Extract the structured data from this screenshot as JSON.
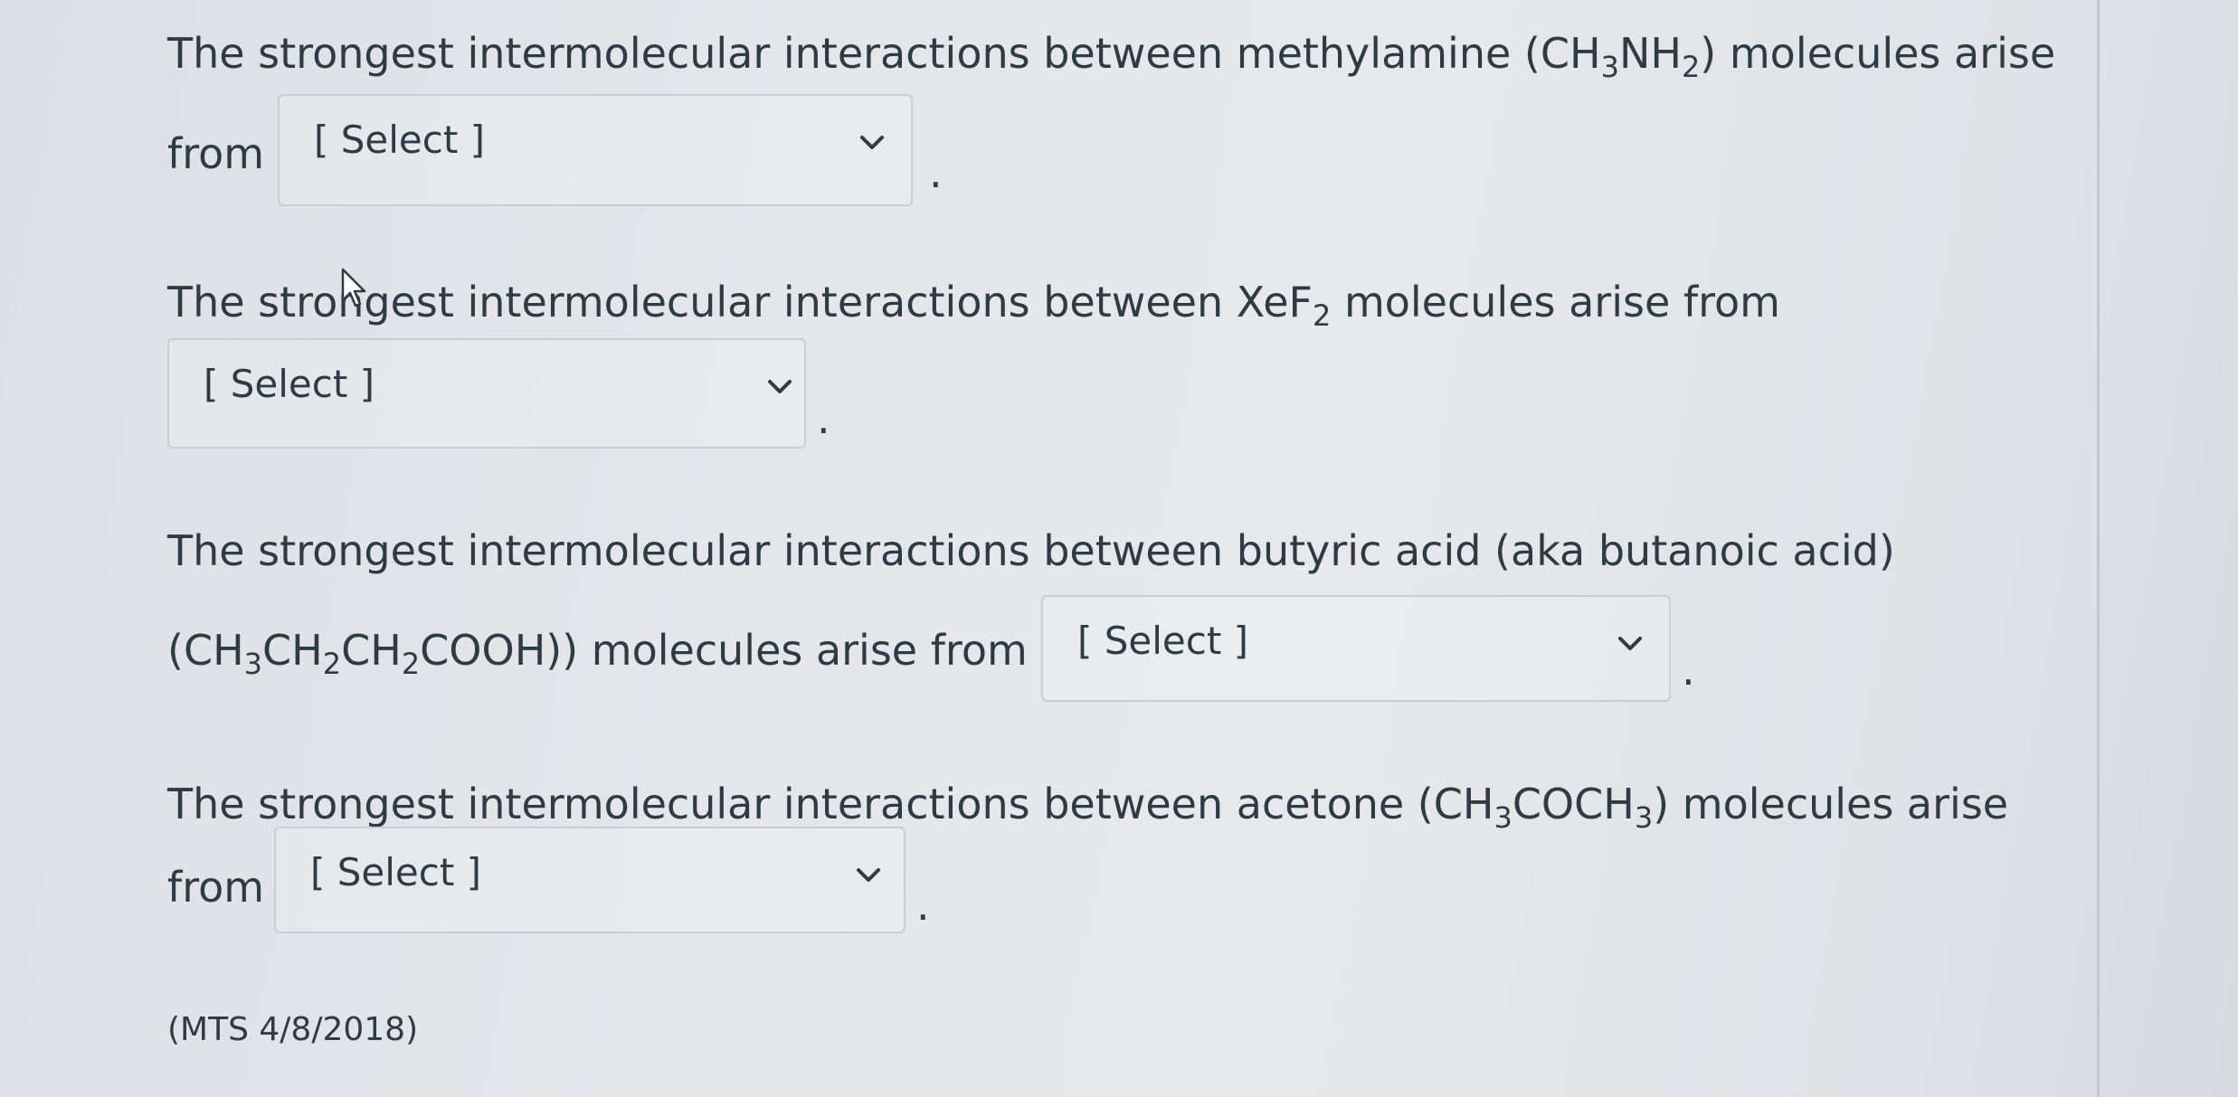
{
  "questions": [
    {
      "line1": {
        "intro": "The strongest intermolecular interactions between methylamine (CH",
        "sub1": "3",
        "mid": "NH",
        "sub2": "2",
        "outro": ") molecules arise"
      },
      "line2_prefix": "from",
      "select_label": "[ Select ]",
      "period": "."
    },
    {
      "line1": {
        "intro": "The strongest intermolecular interactions between XeF",
        "sub1": "2",
        "outro": " molecules arise from"
      },
      "select_label": "[ Select ]",
      "period": "."
    },
    {
      "line1": "The strongest intermolecular interactions between butyric acid (aka butanoic acid)",
      "line2": {
        "p1": "(CH",
        "s1": "3",
        "p2": "CH",
        "s2": "2",
        "p3": "CH",
        "s3": "2",
        "p4": "COOH)) molecules arise from"
      },
      "select_label": "[ Select ]",
      "period": "."
    },
    {
      "line1": {
        "intro": "The strongest intermolecular interactions between acetone (CH",
        "sub1": "3",
        "mid": "COCH",
        "sub2": "3",
        "outro": ") molecules arise"
      },
      "line2_prefix": "from",
      "select_label": "[ Select ]",
      "period": "."
    }
  ],
  "footer": "(MTS 4/8/2018)",
  "icons": {
    "dropdown": "chevron-down-icon",
    "cursor": "mouse-pointer-icon"
  }
}
